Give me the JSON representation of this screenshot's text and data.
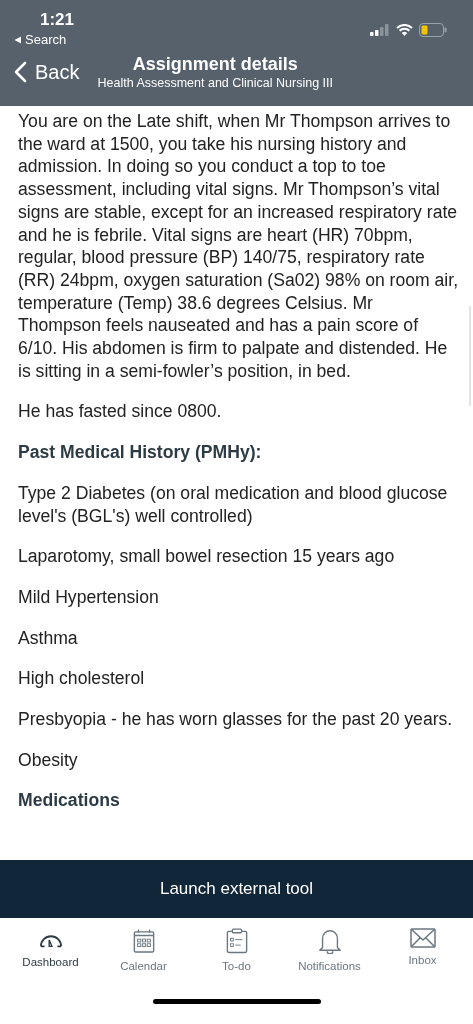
{
  "status_bar": {
    "time": "1:21",
    "back_to_app": "Search"
  },
  "nav": {
    "back": "Back",
    "title": "Assignment details",
    "subtitle": "Health Assessment and Clinical Nursing III"
  },
  "content": [
    {
      "kind": "paragraph",
      "text": "You are on the Late shift, when Mr Thompson arrives to the ward at 1500, you take his nursing history and admission. In doing so you conduct a top to toe assessment, including vital signs. Mr Thompson’s vital signs are stable, except for an increased respiratory rate and he is febrile. Vital signs are heart (HR) 70bpm, regular, blood pressure (BP) 140/75, respiratory rate (RR) 24bpm, oxygen saturation (Sa02) 98% on room air, temperature (Temp) 38.6 degrees Celsius. Mr Thompson feels nauseated and has a pain score of 6/10. His abdomen is firm to palpate and distended. He is sitting in a semi-fowler’s position, in bed."
    },
    {
      "kind": "paragraph",
      "text": "He has fasted since 0800."
    },
    {
      "kind": "heading",
      "text": "Past Medical History (PMHy):"
    },
    {
      "kind": "paragraph",
      "text": "Type 2 Diabetes (on oral medication and blood glucose level's (BGL's) well controlled)"
    },
    {
      "kind": "paragraph",
      "text": "Laparotomy, small bowel resection 15 years ago"
    },
    {
      "kind": "paragraph",
      "text": "Mild Hypertension"
    },
    {
      "kind": "paragraph",
      "text": "Asthma"
    },
    {
      "kind": "paragraph",
      "text": "High cholesterol"
    },
    {
      "kind": "paragraph",
      "text": "Presbyopia - he has worn glasses for the past 20 years."
    },
    {
      "kind": "paragraph",
      "text": "Obesity"
    },
    {
      "kind": "heading",
      "text": "Medications"
    }
  ],
  "launch_button": "Launch external tool",
  "tabs": [
    {
      "kind": "dashboard",
      "label": "Dashboard",
      "selected": true
    },
    {
      "kind": "calendar",
      "label": "Calendar",
      "selected": false
    },
    {
      "kind": "todo",
      "label": "To-do",
      "selected": false
    },
    {
      "kind": "notifications",
      "label": "Notifications",
      "selected": false
    },
    {
      "kind": "inbox",
      "label": "Inbox",
      "selected": false
    }
  ]
}
